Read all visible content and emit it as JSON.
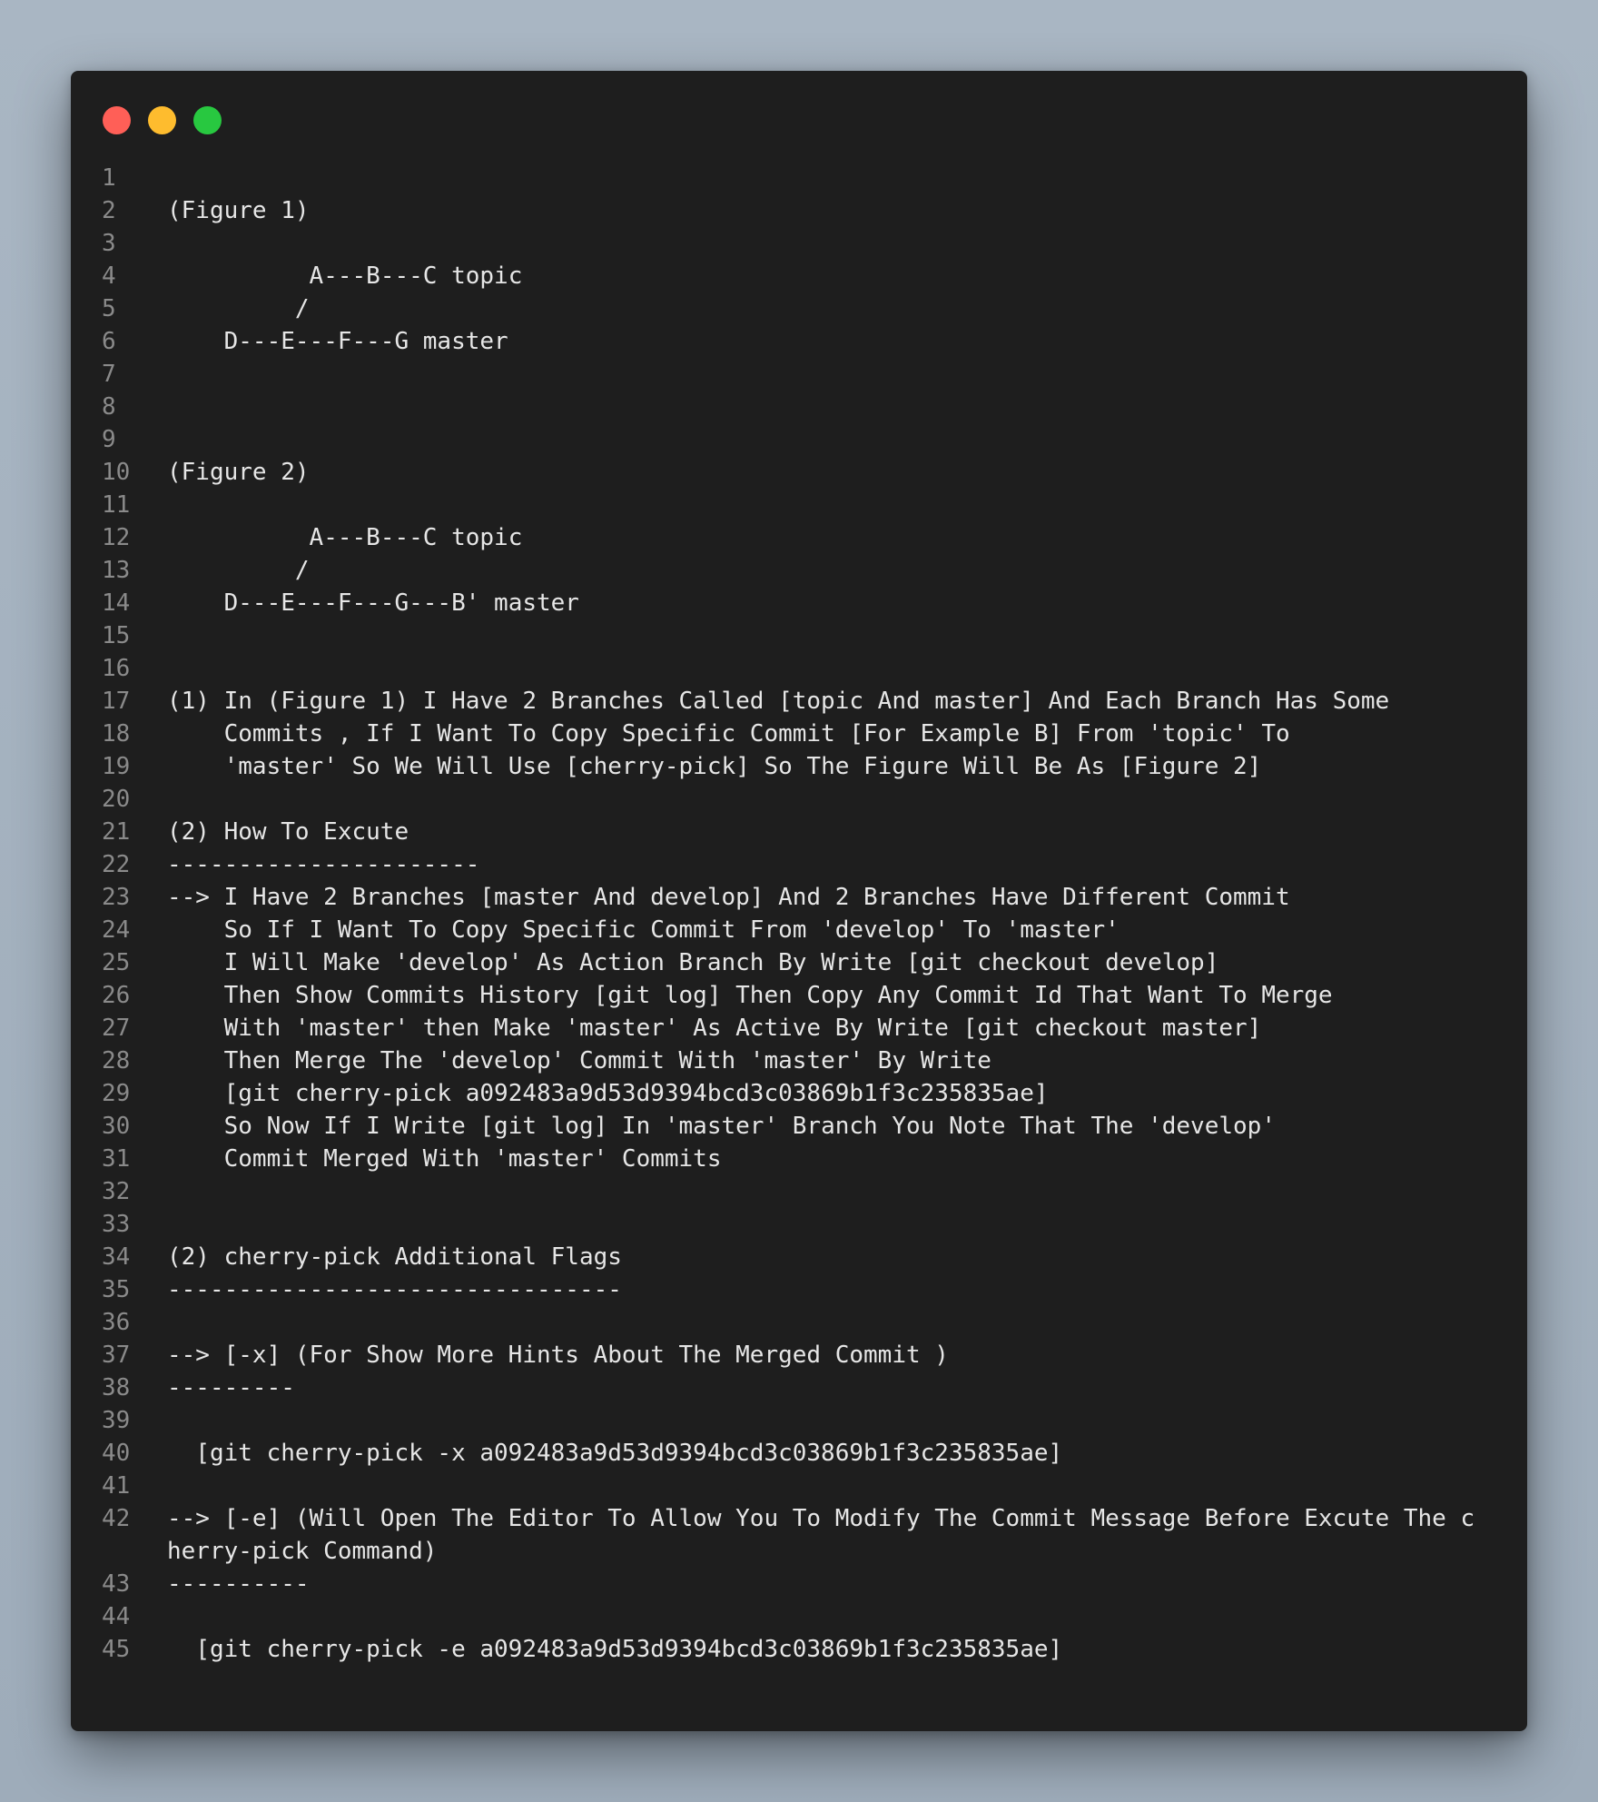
{
  "window": {
    "controls": [
      {
        "name": "close",
        "color": "#ff5f57"
      },
      {
        "name": "minimize",
        "color": "#febc2e"
      },
      {
        "name": "maximize",
        "color": "#28c840"
      }
    ]
  },
  "colors": {
    "background": "#1e1e1e",
    "text": "#e6e6e6",
    "line_numbers": "#8a8a8a"
  },
  "code": {
    "lines": [
      {
        "n": "1",
        "t": ""
      },
      {
        "n": "2",
        "t": "(Figure 1)"
      },
      {
        "n": "3",
        "t": ""
      },
      {
        "n": "4",
        "t": "          A---B---C topic"
      },
      {
        "n": "5",
        "t": "         /"
      },
      {
        "n": "6",
        "t": "    D---E---F---G master"
      },
      {
        "n": "7",
        "t": ""
      },
      {
        "n": "8",
        "t": ""
      },
      {
        "n": "9",
        "t": ""
      },
      {
        "n": "10",
        "t": "(Figure 2)"
      },
      {
        "n": "11",
        "t": ""
      },
      {
        "n": "12",
        "t": "          A---B---C topic"
      },
      {
        "n": "13",
        "t": "         /"
      },
      {
        "n": "14",
        "t": "    D---E---F---G---B' master"
      },
      {
        "n": "15",
        "t": ""
      },
      {
        "n": "16",
        "t": ""
      },
      {
        "n": "17",
        "t": "(1) In (Figure 1) I Have 2 Branches Called [topic And master] And Each Branch Has Some"
      },
      {
        "n": "18",
        "t": "    Commits , If I Want To Copy Specific Commit [For Example B] From 'topic' To"
      },
      {
        "n": "19",
        "t": "    'master' So We Will Use [cherry-pick] So The Figure Will Be As [Figure 2]"
      },
      {
        "n": "20",
        "t": ""
      },
      {
        "n": "21",
        "t": "(2) How To Excute"
      },
      {
        "n": "22",
        "t": "----------------------"
      },
      {
        "n": "23",
        "t": "--> I Have 2 Branches [master And develop] And 2 Branches Have Different Commit"
      },
      {
        "n": "24",
        "t": "    So If I Want To Copy Specific Commit From 'develop' To 'master'"
      },
      {
        "n": "25",
        "t": "    I Will Make 'develop' As Action Branch By Write [git checkout develop]"
      },
      {
        "n": "26",
        "t": "    Then Show Commits History [git log] Then Copy Any Commit Id That Want To Merge"
      },
      {
        "n": "27",
        "t": "    With 'master' then Make 'master' As Active By Write [git checkout master]"
      },
      {
        "n": "28",
        "t": "    Then Merge The 'develop' Commit With 'master' By Write"
      },
      {
        "n": "29",
        "t": "    [git cherry-pick a092483a9d53d9394bcd3c03869b1f3c235835ae]"
      },
      {
        "n": "30",
        "t": "    So Now If I Write [git log] In 'master' Branch You Note That The 'develop'"
      },
      {
        "n": "31",
        "t": "    Commit Merged With 'master' Commits"
      },
      {
        "n": "32",
        "t": ""
      },
      {
        "n": "33",
        "t": ""
      },
      {
        "n": "34",
        "t": "(2) cherry-pick Additional Flags"
      },
      {
        "n": "35",
        "t": "--------------------------------"
      },
      {
        "n": "36",
        "t": ""
      },
      {
        "n": "37",
        "t": "--> [-x] (For Show More Hints About The Merged Commit )"
      },
      {
        "n": "38",
        "t": "---------"
      },
      {
        "n": "39",
        "t": ""
      },
      {
        "n": "40",
        "t": "  [git cherry-pick -x a092483a9d53d9394bcd3c03869b1f3c235835ae]"
      },
      {
        "n": "41",
        "t": ""
      },
      {
        "n": "42",
        "t": "--> [-e] (Will Open The Editor To Allow You To Modify The Commit Message Before Excute The cherry-pick Command)\n"
      },
      {
        "n": "43",
        "t": "----------"
      },
      {
        "n": "44",
        "t": ""
      },
      {
        "n": "45",
        "t": "  [git cherry-pick -e a092483a9d53d9394bcd3c03869b1f3c235835ae]"
      }
    ]
  }
}
